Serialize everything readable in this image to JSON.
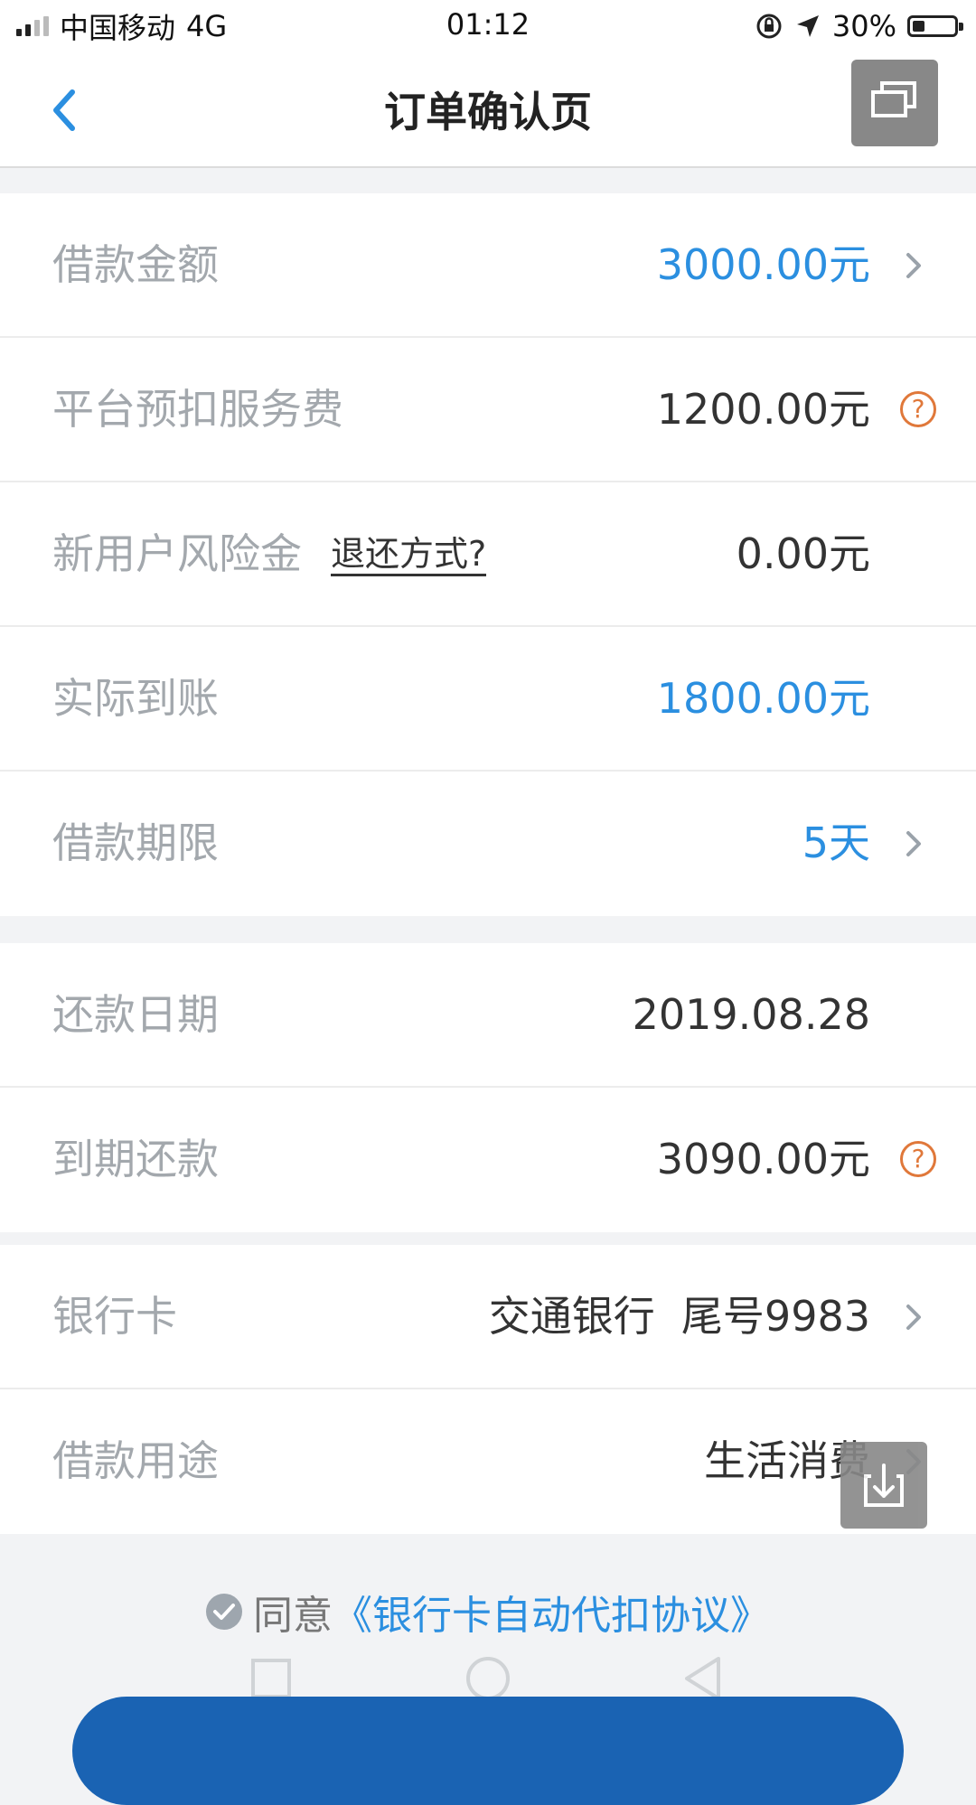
{
  "status_bar": {
    "carrier": "中国移动",
    "network": "4G",
    "time": "01:12",
    "battery_text": "30%",
    "battery_level": 0.3
  },
  "nav": {
    "title": "订单确认页"
  },
  "loan": {
    "amount_label": "借款金额",
    "amount_value": "3000.00元",
    "service_fee_label": "平台预扣服务费",
    "service_fee_value": "1200.00元",
    "help_glyph": "?",
    "risk_label": "新用户风险金",
    "refund_link": "退还方式?",
    "risk_value": "0.00元",
    "received_label": "实际到账",
    "received_value": "1800.00元",
    "term_label": "借款期限",
    "term_value": "5天"
  },
  "repay": {
    "date_label": "还款日期",
    "date_value": "2019.08.28",
    "due_label": "到期还款",
    "due_value": "3090.00元"
  },
  "bank": {
    "card_label": "银行卡",
    "card_value": "交通银行  尾号9983",
    "purpose_label": "借款用途",
    "purpose_value": "生活消费"
  },
  "agreement": {
    "agree_text": "同意",
    "link_text": "《银行卡自动代扣协议》"
  },
  "colors": {
    "accent_blue": "#2b8fe0",
    "help_orange": "#e0783a",
    "button_blue": "#1a63b3"
  }
}
